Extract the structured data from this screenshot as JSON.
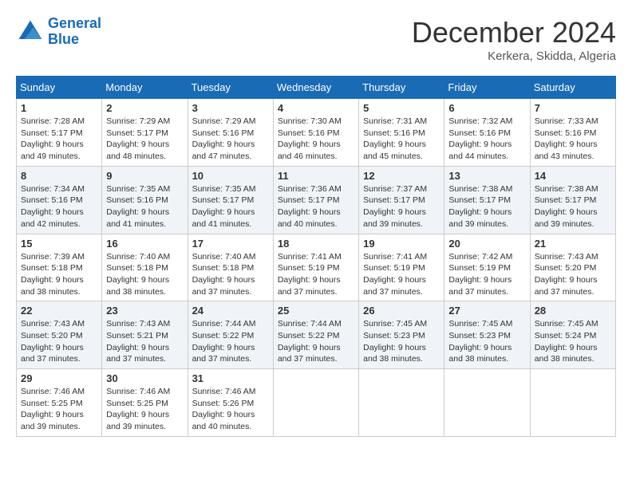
{
  "header": {
    "logo_line1": "General",
    "logo_line2": "Blue",
    "month_title": "December 2024",
    "location": "Kerkera, Skidda, Algeria"
  },
  "weekdays": [
    "Sunday",
    "Monday",
    "Tuesday",
    "Wednesday",
    "Thursday",
    "Friday",
    "Saturday"
  ],
  "weeks": [
    [
      {
        "day": "1",
        "sunrise": "7:28 AM",
        "sunset": "5:17 PM",
        "daylight": "9 hours and 49 minutes."
      },
      {
        "day": "2",
        "sunrise": "7:29 AM",
        "sunset": "5:17 PM",
        "daylight": "9 hours and 48 minutes."
      },
      {
        "day": "3",
        "sunrise": "7:29 AM",
        "sunset": "5:16 PM",
        "daylight": "9 hours and 47 minutes."
      },
      {
        "day": "4",
        "sunrise": "7:30 AM",
        "sunset": "5:16 PM",
        "daylight": "9 hours and 46 minutes."
      },
      {
        "day": "5",
        "sunrise": "7:31 AM",
        "sunset": "5:16 PM",
        "daylight": "9 hours and 45 minutes."
      },
      {
        "day": "6",
        "sunrise": "7:32 AM",
        "sunset": "5:16 PM",
        "daylight": "9 hours and 44 minutes."
      },
      {
        "day": "7",
        "sunrise": "7:33 AM",
        "sunset": "5:16 PM",
        "daylight": "9 hours and 43 minutes."
      }
    ],
    [
      {
        "day": "8",
        "sunrise": "7:34 AM",
        "sunset": "5:16 PM",
        "daylight": "9 hours and 42 minutes."
      },
      {
        "day": "9",
        "sunrise": "7:35 AM",
        "sunset": "5:16 PM",
        "daylight": "9 hours and 41 minutes."
      },
      {
        "day": "10",
        "sunrise": "7:35 AM",
        "sunset": "5:17 PM",
        "daylight": "9 hours and 41 minutes."
      },
      {
        "day": "11",
        "sunrise": "7:36 AM",
        "sunset": "5:17 PM",
        "daylight": "9 hours and 40 minutes."
      },
      {
        "day": "12",
        "sunrise": "7:37 AM",
        "sunset": "5:17 PM",
        "daylight": "9 hours and 39 minutes."
      },
      {
        "day": "13",
        "sunrise": "7:38 AM",
        "sunset": "5:17 PM",
        "daylight": "9 hours and 39 minutes."
      },
      {
        "day": "14",
        "sunrise": "7:38 AM",
        "sunset": "5:17 PM",
        "daylight": "9 hours and 39 minutes."
      }
    ],
    [
      {
        "day": "15",
        "sunrise": "7:39 AM",
        "sunset": "5:18 PM",
        "daylight": "9 hours and 38 minutes."
      },
      {
        "day": "16",
        "sunrise": "7:40 AM",
        "sunset": "5:18 PM",
        "daylight": "9 hours and 38 minutes."
      },
      {
        "day": "17",
        "sunrise": "7:40 AM",
        "sunset": "5:18 PM",
        "daylight": "9 hours and 37 minutes."
      },
      {
        "day": "18",
        "sunrise": "7:41 AM",
        "sunset": "5:19 PM",
        "daylight": "9 hours and 37 minutes."
      },
      {
        "day": "19",
        "sunrise": "7:41 AM",
        "sunset": "5:19 PM",
        "daylight": "9 hours and 37 minutes."
      },
      {
        "day": "20",
        "sunrise": "7:42 AM",
        "sunset": "5:19 PM",
        "daylight": "9 hours and 37 minutes."
      },
      {
        "day": "21",
        "sunrise": "7:43 AM",
        "sunset": "5:20 PM",
        "daylight": "9 hours and 37 minutes."
      }
    ],
    [
      {
        "day": "22",
        "sunrise": "7:43 AM",
        "sunset": "5:20 PM",
        "daylight": "9 hours and 37 minutes."
      },
      {
        "day": "23",
        "sunrise": "7:43 AM",
        "sunset": "5:21 PM",
        "daylight": "9 hours and 37 minutes."
      },
      {
        "day": "24",
        "sunrise": "7:44 AM",
        "sunset": "5:22 PM",
        "daylight": "9 hours and 37 minutes."
      },
      {
        "day": "25",
        "sunrise": "7:44 AM",
        "sunset": "5:22 PM",
        "daylight": "9 hours and 37 minutes."
      },
      {
        "day": "26",
        "sunrise": "7:45 AM",
        "sunset": "5:23 PM",
        "daylight": "9 hours and 38 minutes."
      },
      {
        "day": "27",
        "sunrise": "7:45 AM",
        "sunset": "5:23 PM",
        "daylight": "9 hours and 38 minutes."
      },
      {
        "day": "28",
        "sunrise": "7:45 AM",
        "sunset": "5:24 PM",
        "daylight": "9 hours and 38 minutes."
      }
    ],
    [
      {
        "day": "29",
        "sunrise": "7:46 AM",
        "sunset": "5:25 PM",
        "daylight": "9 hours and 39 minutes."
      },
      {
        "day": "30",
        "sunrise": "7:46 AM",
        "sunset": "5:25 PM",
        "daylight": "9 hours and 39 minutes."
      },
      {
        "day": "31",
        "sunrise": "7:46 AM",
        "sunset": "5:26 PM",
        "daylight": "9 hours and 40 minutes."
      },
      null,
      null,
      null,
      null
    ]
  ]
}
